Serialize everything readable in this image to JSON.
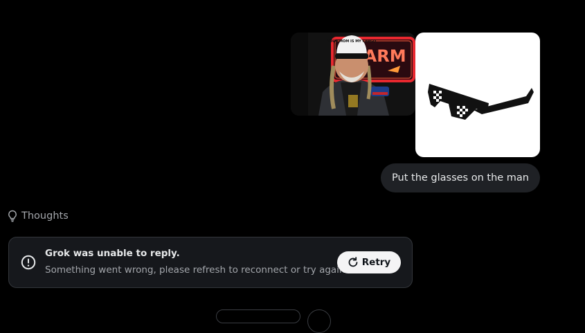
{
  "attachments": [
    {
      "icon": "man-photo",
      "cap_text": "YOUR MOM IS MY CARGO",
      "sign_text": "FARM"
    },
    {
      "icon": "pixel-sunglasses-image"
    }
  ],
  "user_message": "Put the glasses on the man",
  "thoughts": {
    "label": "Thoughts",
    "icon": "lightbulb-icon"
  },
  "error": {
    "icon": "alert-circle-icon",
    "title": "Grok was unable to reply.",
    "message": "Something went wrong, please refresh to reconnect or try again.",
    "retry_label": "Retry",
    "retry_icon": "refresh-icon"
  },
  "colors": {
    "background": "#000000",
    "bubble": "#1f2125",
    "card": "#16181c",
    "card_border": "#33363b",
    "muted_text": "#a3a6ab",
    "retry_bg": "#f4f4f5"
  }
}
